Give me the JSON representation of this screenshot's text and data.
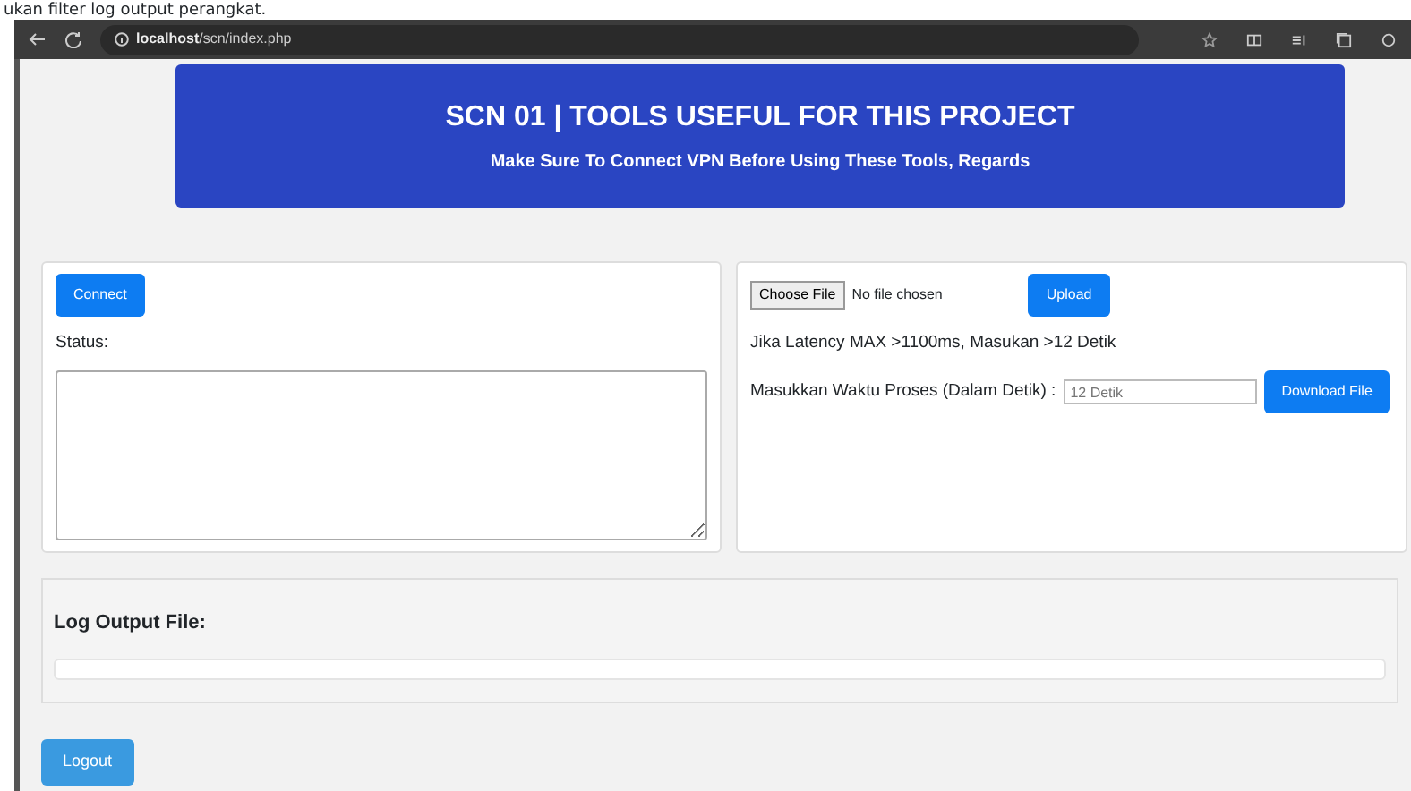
{
  "caption": "ukan filter log output perangkat.",
  "browser": {
    "url_host": "localhost",
    "url_path": "/scn/index.php"
  },
  "header": {
    "title": "SCN 01 | TOOLS USEFUL FOR THIS PROJECT",
    "subtitle": "Make Sure To Connect VPN Before Using These Tools, Regards"
  },
  "left_panel": {
    "connect_button": "Connect",
    "status_label": "Status:"
  },
  "right_panel": {
    "choose_file_button": "Choose File",
    "file_status": "No file chosen",
    "upload_button": "Upload",
    "note": "Jika Latency MAX >1100ms, Masukan >12 Detik",
    "time_label": "Masukkan Waktu Proses (Dalam Detik) :",
    "time_field": {
      "placeholder": "12 Detik"
    },
    "download_button": "Download File"
  },
  "log": {
    "title": "Log Output File:"
  },
  "logout_button": "Logout"
}
